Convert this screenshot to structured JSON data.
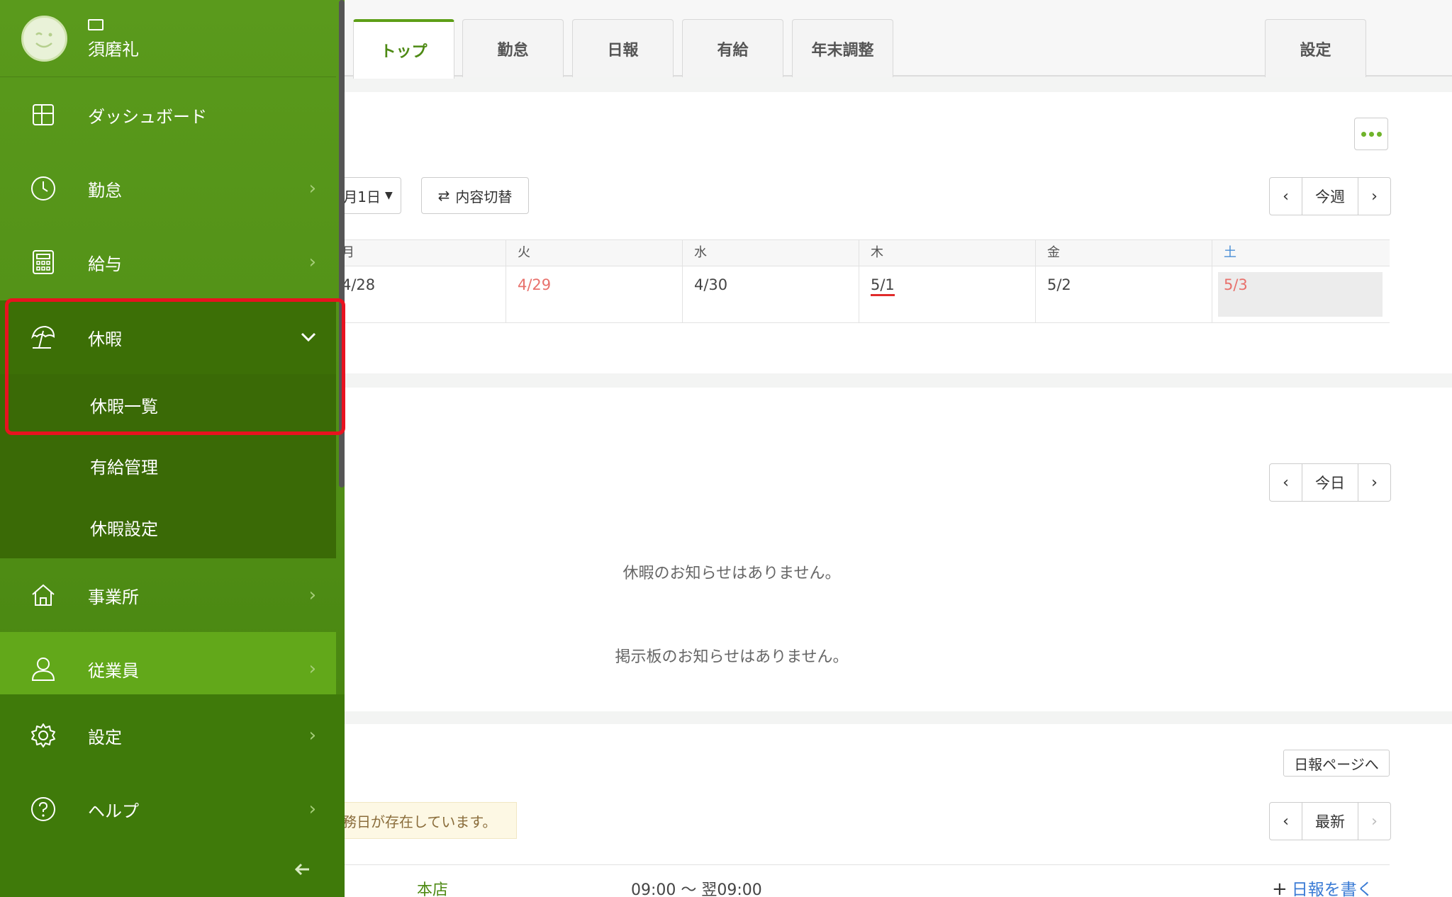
{
  "tabs": [
    {
      "label": "トップ",
      "active": true
    },
    {
      "label": "勤怠"
    },
    {
      "label": "日報"
    },
    {
      "label": "有給"
    },
    {
      "label": "年末調整"
    },
    {
      "label": "設定"
    }
  ],
  "week_card": {
    "date_selector": "月1日",
    "toggle_label": "内容切替",
    "pager": {
      "prev": "‹",
      "label": "今週",
      "next": "›"
    },
    "days": [
      {
        "day": "月",
        "date": "4/28"
      },
      {
        "day": "火",
        "date": "4/29"
      },
      {
        "day": "水",
        "date": "4/30"
      },
      {
        "day": "木",
        "date": "5/1"
      },
      {
        "day": "金",
        "date": "5/2"
      },
      {
        "day": "土",
        "date": "5/3"
      }
    ]
  },
  "notices_card": {
    "pager": {
      "prev": "‹",
      "label": "今日",
      "next": "›"
    },
    "leave_empty": "休暇のお知らせはありません。",
    "board_empty": "掲示板のお知らせはありません。"
  },
  "report_card": {
    "page_button": "日報ページへ",
    "pager": {
      "prev": "‹",
      "label": "最新",
      "next": "›"
    },
    "notice_text": "務日が存在しています。",
    "row": {
      "office": "本店",
      "time": "09:00 ～ 翌09:00",
      "write_link": "日報を書く"
    }
  },
  "sidebar": {
    "user_name": "須磨礼",
    "items": [
      {
        "label": "ダッシュボード",
        "icon": "dashboard-icon"
      },
      {
        "label": "勤怠",
        "icon": "clock-icon"
      },
      {
        "label": "給与",
        "icon": "calculator-icon"
      },
      {
        "label": "休暇",
        "icon": "umbrella-icon"
      },
      {
        "label": "事業所",
        "icon": "home-icon"
      },
      {
        "label": "従業員",
        "icon": "person-icon"
      },
      {
        "label": "設定",
        "icon": "gear-icon"
      },
      {
        "label": "ヘルプ",
        "icon": "help-icon"
      }
    ],
    "leave_sub": [
      {
        "label": "休暇一覧"
      },
      {
        "label": "有給管理"
      },
      {
        "label": "休暇設定"
      }
    ]
  },
  "colors": {
    "brand": "#5a9a1c",
    "highlight": "#e8121f",
    "holiday": "#e8716c",
    "saturday": "#4a8fd6",
    "link": "#3a7bd5"
  }
}
